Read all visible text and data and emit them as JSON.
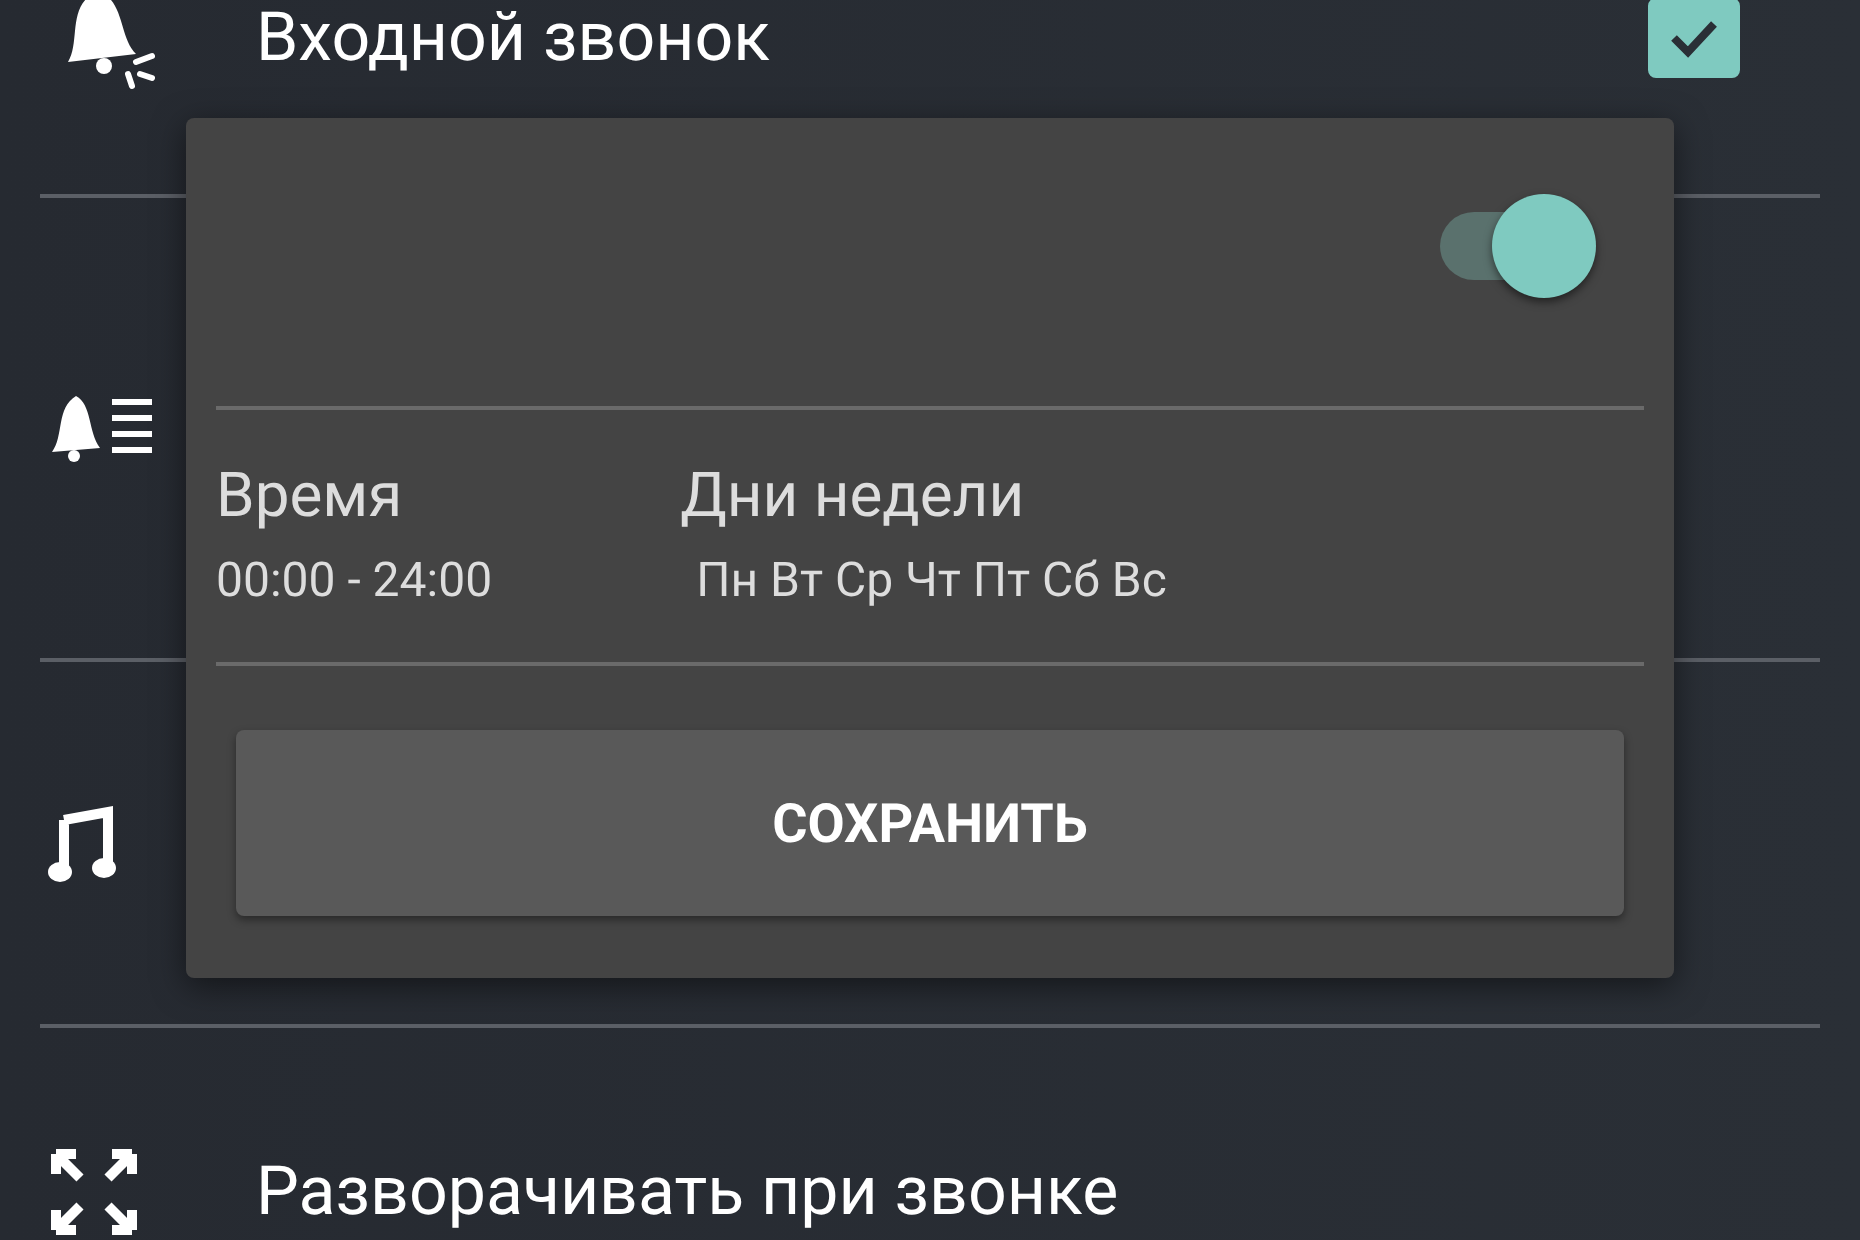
{
  "settings": [
    {
      "kind": "bell",
      "label": "Входной звонок",
      "checked": true
    },
    {
      "kind": "bell-list"
    },
    {
      "kind": "music"
    },
    {
      "kind": "expand",
      "label": "Разворачивать при звонке"
    }
  ],
  "dialog": {
    "enabled": true,
    "time_label": "Время",
    "time_value": "00:00 - 24:00",
    "days_label": "Дни недели",
    "days_value": "Пн Вт Ср Чт Пт Сб Вс",
    "save_button": "СОХРАНИТЬ"
  }
}
